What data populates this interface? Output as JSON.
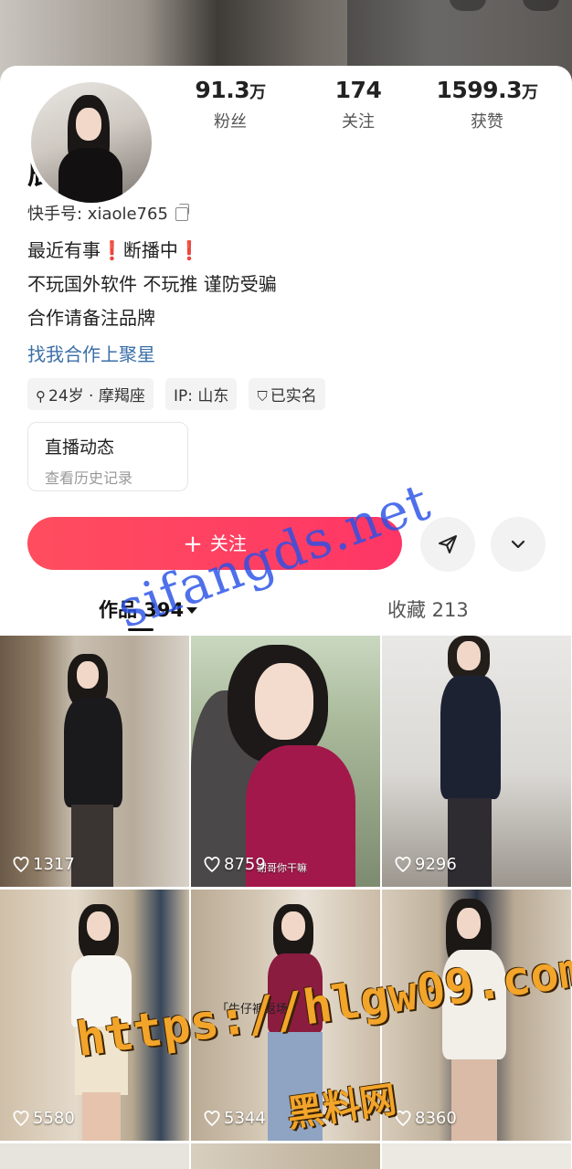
{
  "profile": {
    "name": "辰妈吖",
    "kwai_id": "快手号: xiaole765",
    "stats": [
      {
        "value": "91.3",
        "unit": "万",
        "label": "粉丝"
      },
      {
        "value": "174",
        "unit": "",
        "label": "关注"
      },
      {
        "value": "1599.3",
        "unit": "万",
        "label": "获赞"
      }
    ],
    "bio": {
      "line1_a": "最近有事",
      "line1_b": "断播中",
      "line2": "不玩国外软件 不玩推  谨防受骗",
      "line3": "合作请备注品牌"
    },
    "link": "找我合作上聚星",
    "tags": [
      "24岁 · 摩羯座",
      "IP: 山东",
      "已实名"
    ]
  },
  "live": {
    "title": "直播动态",
    "subtitle": "查看历史记录"
  },
  "actions": {
    "follow_label": "关注"
  },
  "tabs": {
    "works": "作品 394",
    "favorites": "收藏 213"
  },
  "posts": [
    {
      "likes": "1317"
    },
    {
      "likes": "8759",
      "caption": "谢哥你干嘛"
    },
    {
      "likes": "9296"
    },
    {
      "likes": "5580"
    },
    {
      "likes": "5344",
      "caption": "「牛仔裤返场」"
    },
    {
      "likes": "8360"
    }
  ],
  "watermarks": {
    "blue": "sifangds.net",
    "url": "https://hlgw09.com",
    "cn": "黑料网"
  },
  "colors": {
    "follow": "#fe3666",
    "link": "#3b6fa8",
    "bang": "#e02323"
  }
}
